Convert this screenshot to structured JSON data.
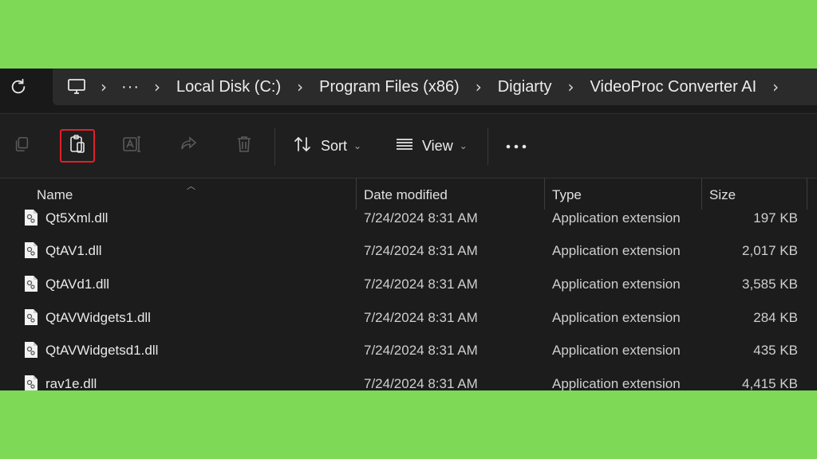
{
  "address_bar": {
    "refresh_icon": "refresh-icon",
    "this_pc_icon": "monitor-icon",
    "overflow": "···",
    "crumbs": [
      "Local Disk (C:)",
      "Program Files (x86)",
      "Digiarty",
      "VideoProc Converter AI"
    ]
  },
  "toolbar": {
    "copy_icon": "copy-icon",
    "paste_icon": "paste-icon",
    "rename_icon": "rename-icon",
    "share_icon": "share-icon",
    "delete_icon": "trash-icon",
    "sort_label": "Sort",
    "view_label": "View",
    "more_icon": "more-icon",
    "highlight_color": "#e0202a"
  },
  "columns": {
    "name": "Name",
    "date": "Date modified",
    "type": "Type",
    "size": "Size"
  },
  "files": [
    {
      "name": "Qt5Xml.dll",
      "date": "7/24/2024 8:31 AM",
      "type": "Application extension",
      "size": "197 KB"
    },
    {
      "name": "QtAV1.dll",
      "date": "7/24/2024 8:31 AM",
      "type": "Application extension",
      "size": "2,017 KB"
    },
    {
      "name": "QtAVd1.dll",
      "date": "7/24/2024 8:31 AM",
      "type": "Application extension",
      "size": "3,585 KB"
    },
    {
      "name": "QtAVWidgets1.dll",
      "date": "7/24/2024 8:31 AM",
      "type": "Application extension",
      "size": "284 KB"
    },
    {
      "name": "QtAVWidgetsd1.dll",
      "date": "7/24/2024 8:31 AM",
      "type": "Application extension",
      "size": "435 KB"
    },
    {
      "name": "rav1e.dll",
      "date": "7/24/2024 8:31 AM",
      "type": "Application extension",
      "size": "4,415 KB"
    }
  ],
  "colors": {
    "background": "#7ed957",
    "window": "#1c1c1c",
    "breadcrumb_bg": "#2b2b2b"
  }
}
